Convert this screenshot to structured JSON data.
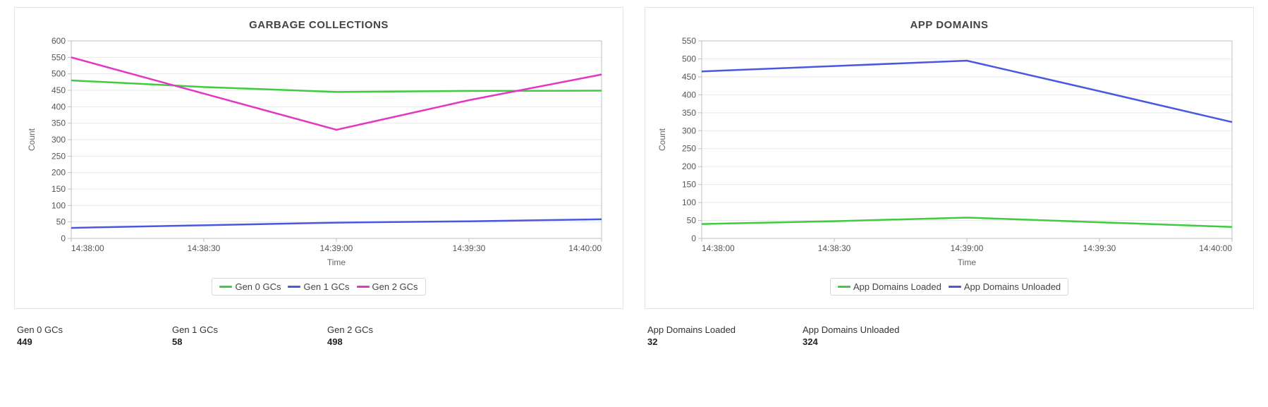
{
  "charts": [
    {
      "id": "gc",
      "title": "GARBAGE COLLECTIONS",
      "ylabel": "Count",
      "xlabel": "Time"
    },
    {
      "id": "ad",
      "title": "APP DOMAINS",
      "ylabel": "Count",
      "xlabel": "Time"
    }
  ],
  "stats": {
    "gc": [
      {
        "label": "Gen 0 GCs",
        "value": "449"
      },
      {
        "label": "Gen 1 GCs",
        "value": "58"
      },
      {
        "label": "Gen 2 GCs",
        "value": "498"
      }
    ],
    "ad": [
      {
        "label": "App Domains Loaded",
        "value": "32"
      },
      {
        "label": "App Domains Unloaded",
        "value": "324"
      }
    ]
  },
  "colors": {
    "green": "#3fcc3f",
    "blue": "#4a57e0",
    "magenta": "#e435c4"
  },
  "chart_data": [
    {
      "type": "line",
      "title": "GARBAGE COLLECTIONS",
      "xlabel": "Time",
      "ylabel": "Count",
      "x_ticks": [
        "14:38:00",
        "14:38:30",
        "14:39:00",
        "14:39:30",
        "14:40:00"
      ],
      "y_ticks": [
        0,
        50,
        100,
        150,
        200,
        250,
        300,
        350,
        400,
        450,
        500,
        550,
        600
      ],
      "ylim": [
        0,
        600
      ],
      "series": [
        {
          "name": "Gen 0 GCs",
          "color": "green",
          "x": [
            "14:38:00",
            "14:38:30",
            "14:39:00",
            "14:39:30",
            "14:40:00"
          ],
          "values": [
            480,
            460,
            445,
            448,
            449
          ]
        },
        {
          "name": "Gen 1 GCs",
          "color": "blue",
          "x": [
            "14:38:00",
            "14:38:30",
            "14:39:00",
            "14:39:30",
            "14:40:00"
          ],
          "values": [
            32,
            40,
            48,
            52,
            58
          ]
        },
        {
          "name": "Gen 2 GCs",
          "color": "magenta",
          "x": [
            "14:38:00",
            "14:38:30",
            "14:39:00",
            "14:39:30",
            "14:40:00"
          ],
          "values": [
            550,
            440,
            330,
            420,
            498
          ]
        }
      ]
    },
    {
      "type": "line",
      "title": "APP DOMAINS",
      "xlabel": "Time",
      "ylabel": "Count",
      "x_ticks": [
        "14:38:00",
        "14:38:30",
        "14:39:00",
        "14:39:30",
        "14:40:00"
      ],
      "y_ticks": [
        0,
        50,
        100,
        150,
        200,
        250,
        300,
        350,
        400,
        450,
        500,
        550
      ],
      "ylim": [
        0,
        550
      ],
      "series": [
        {
          "name": "App Domains Loaded",
          "color": "green",
          "x": [
            "14:38:00",
            "14:38:30",
            "14:39:00",
            "14:39:30",
            "14:40:00"
          ],
          "values": [
            40,
            48,
            58,
            45,
            32
          ]
        },
        {
          "name": "App Domains Unloaded",
          "color": "blue",
          "x": [
            "14:38:00",
            "14:38:30",
            "14:39:00",
            "14:39:30",
            "14:40:00"
          ],
          "values": [
            465,
            480,
            495,
            410,
            324
          ]
        }
      ]
    }
  ]
}
